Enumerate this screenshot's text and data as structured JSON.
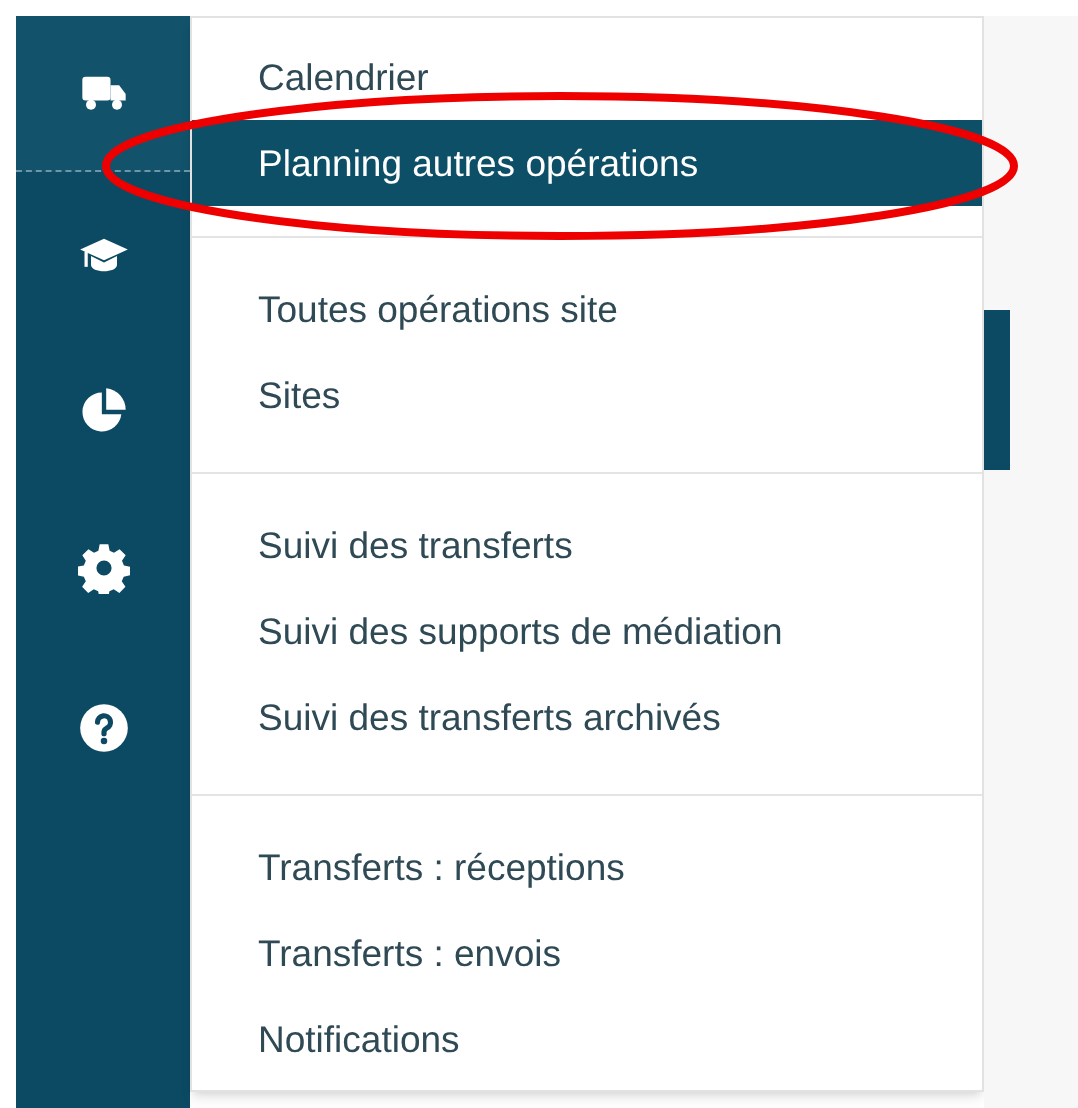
{
  "sidebar": {
    "items": [
      {
        "kind": "truck",
        "selected": true
      },
      {
        "kind": "cap",
        "selected": false
      },
      {
        "kind": "pie",
        "selected": false
      },
      {
        "kind": "settings",
        "selected": false
      },
      {
        "kind": "help",
        "selected": false
      }
    ]
  },
  "menu": {
    "groups": [
      {
        "items": [
          {
            "label": "Calendrier",
            "selected": false
          },
          {
            "label": "Planning autres opérations",
            "selected": true
          }
        ]
      },
      {
        "items": [
          {
            "label": "Toutes opérations site",
            "selected": false
          },
          {
            "label": "Sites",
            "selected": false
          }
        ]
      },
      {
        "items": [
          {
            "label": "Suivi des transferts",
            "selected": false
          },
          {
            "label": "Suivi des supports de médiation",
            "selected": false
          },
          {
            "label": "Suivi des transferts archivés",
            "selected": false
          }
        ]
      },
      {
        "items": [
          {
            "label": "Transferts : réceptions",
            "selected": false
          },
          {
            "label": "Transferts : envois",
            "selected": false
          },
          {
            "label": "Notifications",
            "selected": false
          }
        ]
      }
    ]
  }
}
